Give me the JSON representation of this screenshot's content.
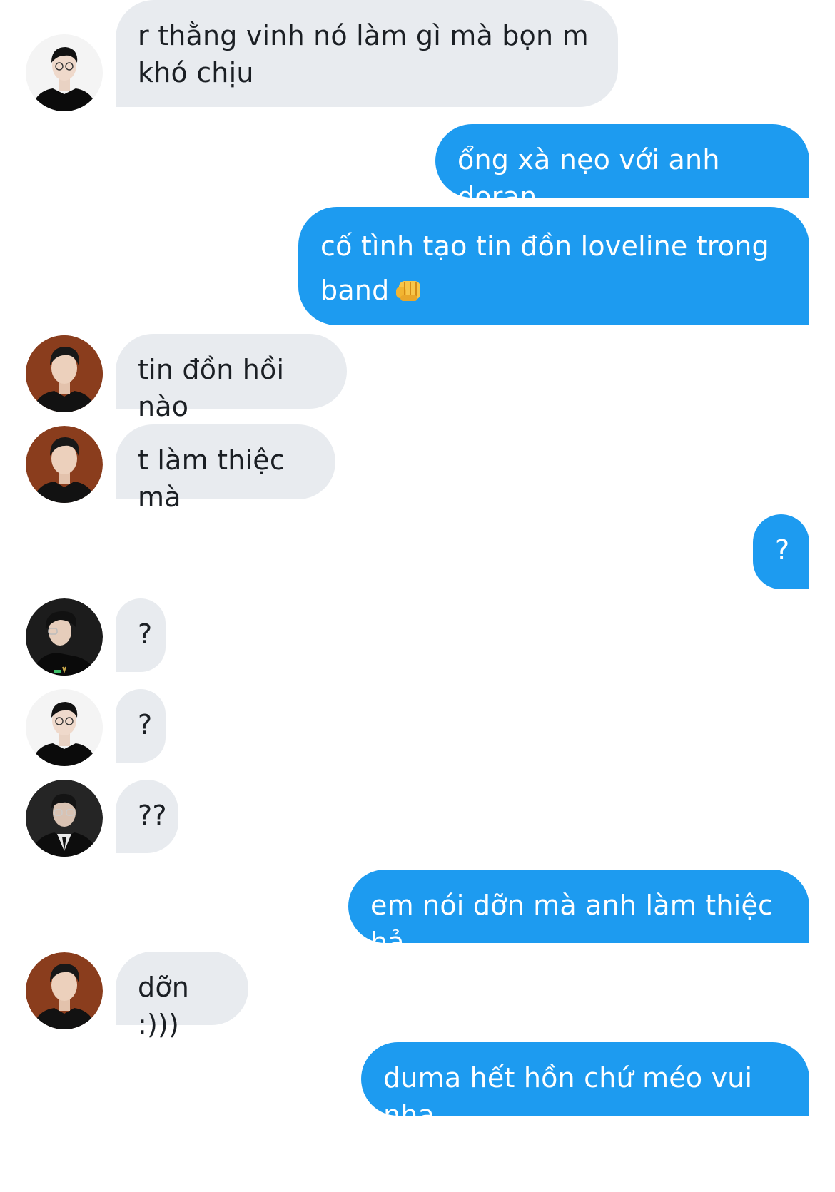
{
  "thread": {
    "messages": [
      {
        "id": "m1",
        "direction": "incoming",
        "sender_avatar": "avatar-black-sweater",
        "text": "r thằng vinh nó làm gì mà bọn m\nkhó chịu"
      },
      {
        "id": "m2",
        "direction": "outgoing",
        "text": "ổng xà nẹo với anh doran"
      },
      {
        "id": "m3",
        "direction": "outgoing",
        "text": "cố tình tạo tin đồn loveline trong\nband",
        "emoji": "oncoming-fist"
      },
      {
        "id": "m4",
        "direction": "incoming",
        "sender_avatar": "avatar-orange-bg",
        "text": "tin đồn hồi nào"
      },
      {
        "id": "m5",
        "direction": "incoming",
        "sender_avatar": "avatar-orange-bg",
        "text": "t làm thiệc mà"
      },
      {
        "id": "m6",
        "direction": "outgoing",
        "text": "?"
      },
      {
        "id": "m7",
        "direction": "incoming",
        "sender_avatar": "avatar-glasses-dark",
        "text": "?"
      },
      {
        "id": "m8",
        "direction": "incoming",
        "sender_avatar": "avatar-black-sweater",
        "text": "?"
      },
      {
        "id": "m9",
        "direction": "incoming",
        "sender_avatar": "avatar-suit-tie",
        "text": "??"
      },
      {
        "id": "m10",
        "direction": "outgoing",
        "text": "em nói dỡn mà anh làm thiệc hả"
      },
      {
        "id": "m11",
        "direction": "incoming",
        "sender_avatar": "avatar-orange-bg",
        "text": "dỡn :)))"
      },
      {
        "id": "m12",
        "direction": "outgoing",
        "text": "duma hết hồn chứ méo vui nha"
      }
    ]
  },
  "colors": {
    "incoming_bubble": "#e8ebef",
    "incoming_text": "#1b1f24",
    "outgoing_bubble": "#1d9bf0",
    "outgoing_text": "#ffffff"
  }
}
